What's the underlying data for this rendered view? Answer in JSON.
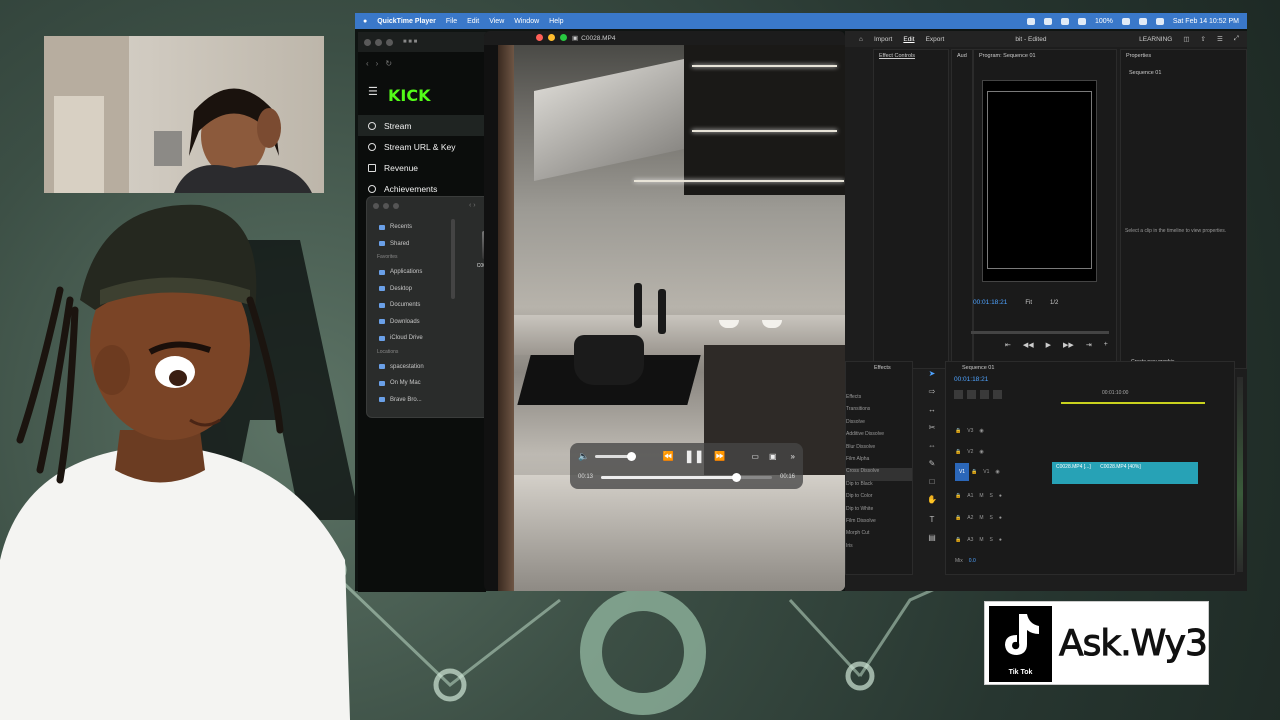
{
  "menubar": {
    "app_name": "QuickTime Player",
    "menus": [
      "File",
      "Edit",
      "View",
      "Window",
      "Help"
    ],
    "battery": "100%",
    "datetime": "Sat Feb 14 10:52 PM"
  },
  "browser": {
    "site_logo": "KICK",
    "nav_items": [
      {
        "label": "Stream",
        "icon": "radio-icon"
      },
      {
        "label": "Stream URL & Key",
        "icon": "link-icon"
      },
      {
        "label": "Revenue",
        "icon": "revenue-icon"
      },
      {
        "label": "Achievements",
        "icon": "trophy-icon"
      }
    ]
  },
  "finder": {
    "items": [
      "Recents",
      "Shared"
    ],
    "favorites_label": "Favorites",
    "favorites": [
      "Applications",
      "Desktop",
      "Documents",
      "Downloads",
      "iCloud Drive"
    ],
    "locations_label": "Locations",
    "locations": [
      "spacestation",
      "On My Mac",
      "Brave Bro..."
    ],
    "file_name": "C0028.MP4"
  },
  "quicktime": {
    "title": "C0028.MP4",
    "time_elapsed": "00:13",
    "time_remaining": "00:16",
    "progress": 0.79,
    "volume": 1.0
  },
  "premiere": {
    "workspace_tabs": [
      "Import",
      "Edit",
      "Export"
    ],
    "active_tab": "Edit",
    "project_title": "bit - Edited",
    "workspace_label": "LEARNING",
    "effect_controls_tab": "Effect Controls",
    "audio_tab": "Aud",
    "program_tab": "Program: Sequence 01",
    "properties_tab": "Properties",
    "sequence_name": "Sequence 01",
    "properties_hint": "Select a clip in the timeline to view properties.",
    "program_timecode": "00:01:18:21",
    "fit_label": "Fit",
    "resolution_label": "1/2",
    "create_graphic": "Create new graphic",
    "effects_tab": "Effects",
    "timeline_tab": "Sequence 01",
    "timeline_timecode": "00:01:18:21",
    "ruler_time": "00:01:10:00",
    "effects_list": [
      "Effects",
      "Transitions",
      "Dissolve",
      "Additive Dissolve",
      "Blur Dissolve",
      "Film Alpha",
      "Cross Dissolve",
      "Dip to Black",
      "Dip to Color",
      "Dip to White",
      "Film Dissolve",
      "Morph Cut",
      "Iris"
    ],
    "video_tracks": [
      "V3",
      "V2",
      "V1"
    ],
    "audio_tracks": [
      "A1",
      "A2",
      "A3"
    ],
    "mix_label": "Mix",
    "mix_value": "0.0",
    "clip_label_1": "C0028.MP4 [...]",
    "clip_label_2": "C0028.MP4 [40%]"
  },
  "tiktok": {
    "label": "Tik Tok",
    "handle": "Ask.Wy3"
  }
}
